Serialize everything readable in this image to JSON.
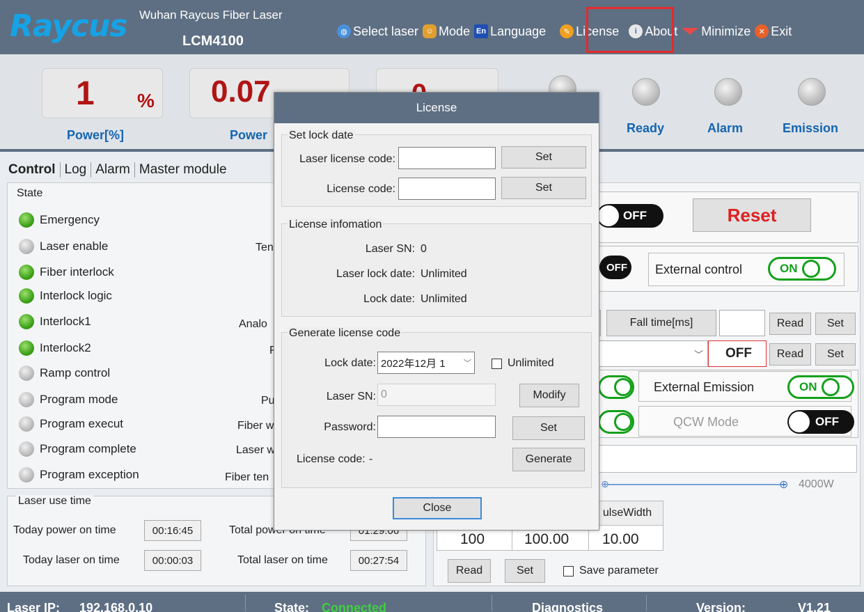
{
  "header": {
    "logo": "Raycus",
    "title": "Wuhan Raycus Fiber Laser",
    "model": "LCM4100",
    "menu": [
      {
        "label": "Select laser",
        "icon": "globe-icon"
      },
      {
        "label": "Mode",
        "icon": "users-icon"
      },
      {
        "label": "Language",
        "icon": "en-icon"
      },
      {
        "label": "License",
        "icon": "key-icon"
      },
      {
        "label": "About",
        "icon": "info-icon"
      },
      {
        "label": "Minimize",
        "icon": "minimize-icon"
      },
      {
        "label": "Exit",
        "icon": "close-icon"
      }
    ],
    "en_badge": "En"
  },
  "meters": {
    "power_pct_value": "1",
    "power_pct_unit": "%",
    "power_pct_label": "Power[%]",
    "power_value": "0.07",
    "power_label": "Power",
    "third_value": "0"
  },
  "indicators": {
    "ready": "Ready",
    "alarm": "Alarm",
    "emission": "Emission"
  },
  "tabs": [
    "Control",
    "Log",
    "Alarm",
    "Master module"
  ],
  "state": {
    "title": "State",
    "items": [
      {
        "label": "Emergency",
        "status": "green"
      },
      {
        "label": "Laser enable",
        "status": "grey"
      },
      {
        "label": "Fiber interlock",
        "status": "green"
      },
      {
        "label": "Interlock logic",
        "status": "green"
      },
      {
        "label": "Interlock1",
        "status": "green"
      },
      {
        "label": "Interlock2",
        "status": "green"
      },
      {
        "label": "Ramp control",
        "status": "grey"
      },
      {
        "label": "Program mode",
        "status": "grey"
      },
      {
        "label": "Program execut",
        "status": "grey"
      },
      {
        "label": "Program complete",
        "status": "grey"
      },
      {
        "label": "Program exception",
        "status": "grey"
      }
    ],
    "middle_labels": [
      "Ten",
      "Analo",
      "F",
      "Pu",
      "Fiber w",
      "Laser w",
      "Fiber ten"
    ]
  },
  "usetime": {
    "title": "Laser use time",
    "today_power_on_label": "Today power on time",
    "today_power_on_value": "00:16:45",
    "total_power_on_label": "Total power on time",
    "total_power_on_value": "01:29:06",
    "today_laser_on_label": "Today laser on time",
    "today_laser_on_value": "00:00:03",
    "total_laser_on_label": "Total laser on time",
    "total_laser_on_value": "00:27:54"
  },
  "control": {
    "toggle_off": "OFF",
    "toggle_on": "ON",
    "reset": "Reset",
    "external_control": "External control",
    "fall_time": "Fall time[ms]",
    "read": "Read",
    "set": "Set",
    "off_box": "OFF",
    "external_emission": "External Emission",
    "qcw_mode": "QCW Mode",
    "slider_max": "4000W",
    "pulse_width_header": "ulseWidth",
    "values": [
      "100",
      "100.00",
      "10.00"
    ],
    "save_parameter": "Save parameter"
  },
  "footer": {
    "ip_label": "Laser IP:",
    "ip_value": "192.168.0.10",
    "state_label": "State:",
    "state_value": "Connected",
    "diagnostics": "Diagnostics",
    "version_label": "Version:",
    "version_value": "V1.21"
  },
  "dialog": {
    "title": "License",
    "set_lock_date": "Set lock date",
    "laser_license_code_label": "Laser license code:",
    "license_code_label": "License code:",
    "set": "Set",
    "license_info": "License infomation",
    "laser_sn_label": "Laser SN:",
    "laser_sn_value": "0",
    "laser_lock_date_label": "Laser lock date:",
    "laser_lock_date_value": "Unlimited",
    "lock_date_label": "Lock date:",
    "lock_date_value": "Unlimited",
    "generate_group": "Generate license code",
    "gen_lock_date_label": "Lock date:",
    "gen_lock_date_value": "2022年12月 1",
    "unlimited": "Unlimited",
    "gen_laser_sn_label": "Laser SN:",
    "gen_laser_sn_value": "0",
    "modify": "Modify",
    "password_label": "Password:",
    "gen_license_code_label": "License code:",
    "gen_license_code_value": "-",
    "generate": "Generate",
    "close": "Close"
  }
}
